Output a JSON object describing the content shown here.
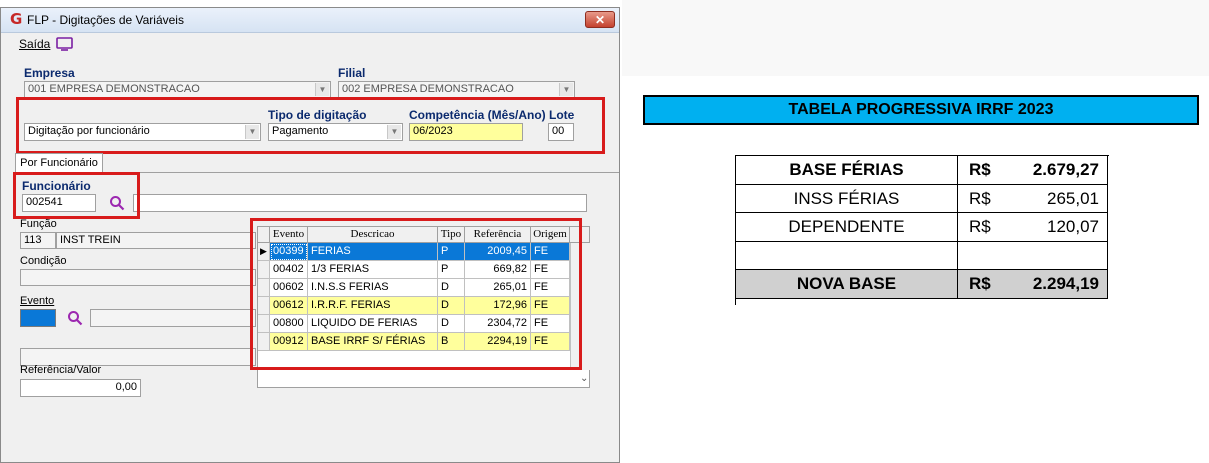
{
  "window": {
    "title": "FLP - Digitações de Variáveis",
    "close_label": "✕"
  },
  "menu": {
    "exit_label": "Saída"
  },
  "empresa": {
    "label": "Empresa",
    "value": "001 EMPRESA DEMONSTRACAO"
  },
  "filial": {
    "label": "Filial",
    "value": "002 EMPRESA DEMONSTRACAO"
  },
  "digitacao": {
    "value": "Digitação por funcionário"
  },
  "tipo_digitacao": {
    "label": "Tipo de digitação",
    "value": "Pagamento"
  },
  "competencia": {
    "label": "Competência (Mês/Ano)",
    "value": "06/2023"
  },
  "lote": {
    "label": "Lote",
    "value": "00"
  },
  "tab": {
    "label": "Por Funcionário"
  },
  "funcionario": {
    "label": "Funcionário",
    "value": "002541",
    "name": ""
  },
  "funcao": {
    "label": "Função",
    "code": "113",
    "name": "INST TREIN"
  },
  "condicao": {
    "label": "Condição"
  },
  "evento": {
    "label": "Evento"
  },
  "referencia_valor": {
    "label": "Referência/Valor",
    "value": "0,00"
  },
  "grid": {
    "headers": [
      "Evento",
      "Descricao",
      "Tipo",
      "Referência",
      "Origem"
    ],
    "rows": [
      {
        "evento": "00399",
        "descricao": "FERIAS",
        "tipo": "P",
        "referencia": "2009,45",
        "origem": "FE",
        "style": "selected"
      },
      {
        "evento": "00402",
        "descricao": "1/3 FERIAS",
        "tipo": "P",
        "referencia": "669,82",
        "origem": "FE",
        "style": "normal"
      },
      {
        "evento": "00602",
        "descricao": "I.N.S.S FERIAS",
        "tipo": "D",
        "referencia": "265,01",
        "origem": "FE",
        "style": "normal"
      },
      {
        "evento": "00612",
        "descricao": "I.R.R.F. FERIAS",
        "tipo": "D",
        "referencia": "172,96",
        "origem": "FE",
        "style": "yellow"
      },
      {
        "evento": "00800",
        "descricao": "LIQUIDO DE FERIAS",
        "tipo": "D",
        "referencia": "2304,72",
        "origem": "FE",
        "style": "normal"
      },
      {
        "evento": "00912",
        "descricao": "BASE IRRF S/ FÉRIAS",
        "tipo": "B",
        "referencia": "2294,19",
        "origem": "FE",
        "style": "yellow"
      }
    ]
  },
  "sheet": {
    "title": "TABELA PROGRESSIVA IRRF 2023",
    "rows": [
      {
        "label": "BASE FÉRIAS",
        "currency": "R$",
        "value": "2.679,27",
        "bold": true,
        "shaded": false
      },
      {
        "label": "INSS FÉRIAS",
        "currency": "R$",
        "value": "265,01",
        "bold": false,
        "shaded": false
      },
      {
        "label": "DEPENDENTE",
        "currency": "R$",
        "value": "120,07",
        "bold": false,
        "shaded": false
      },
      {
        "label": "",
        "currency": "",
        "value": "",
        "bold": false,
        "shaded": false
      },
      {
        "label": "NOVA BASE",
        "currency": "R$",
        "value": "2.294,19",
        "bold": true,
        "shaded": true
      }
    ]
  },
  "colors": {
    "selected_row": "#0a78d7",
    "highlight_row": "#ffff9c",
    "sheet_header": "#00b0f0",
    "sheet_shaded": "#d0d0d0",
    "annotation": "#d81b1b"
  }
}
